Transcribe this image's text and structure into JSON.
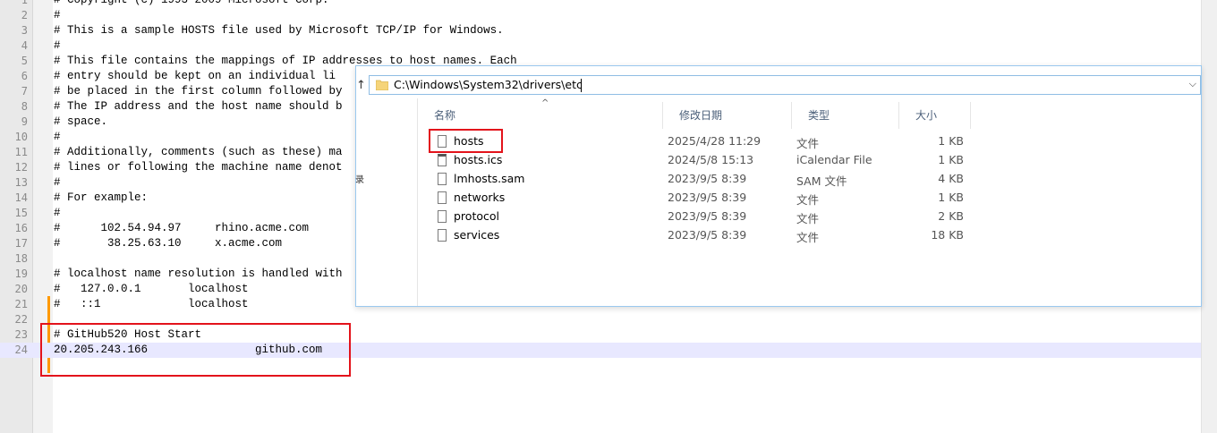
{
  "editor": {
    "lines": [
      {
        "num": "1",
        "text": "# Copyright (c) 1993-2009 Microsoft Corp."
      },
      {
        "num": "2",
        "text": "#"
      },
      {
        "num": "3",
        "text": "# This is a sample HOSTS file used by Microsoft TCP/IP for Windows."
      },
      {
        "num": "4",
        "text": "#"
      },
      {
        "num": "5",
        "text": "# This file contains the mappings of IP addresses to host names. Each"
      },
      {
        "num": "6",
        "text": "# entry should be kept on an individual li"
      },
      {
        "num": "7",
        "text": "# be placed in the first column followed by"
      },
      {
        "num": "8",
        "text": "# The IP address and the host name should b"
      },
      {
        "num": "9",
        "text": "# space."
      },
      {
        "num": "10",
        "text": "#"
      },
      {
        "num": "11",
        "text": "# Additionally, comments (such as these) ma"
      },
      {
        "num": "12",
        "text": "# lines or following the machine name denot"
      },
      {
        "num": "13",
        "text": "#"
      },
      {
        "num": "14",
        "text": "# For example:"
      },
      {
        "num": "15",
        "text": "#"
      },
      {
        "num": "16",
        "text": "#      102.54.94.97     rhino.acme.com"
      },
      {
        "num": "17",
        "text": "#       38.25.63.10     x.acme.com"
      },
      {
        "num": "18",
        "text": ""
      },
      {
        "num": "19",
        "text": "# localhost name resolution is handled with"
      },
      {
        "num": "20",
        "text": "#   127.0.0.1       localhost"
      },
      {
        "num": "21",
        "text": "#   ::1             localhost"
      },
      {
        "num": "22",
        "text": ""
      },
      {
        "num": "23",
        "text": "# GitHub520 Host Start"
      },
      {
        "num": "24",
        "text": "20.205.243.166                github.com"
      }
    ],
    "current_line": 24
  },
  "explorer": {
    "address_path": "C:\\Windows\\System32\\drivers\\etc",
    "columns": {
      "name": "名称",
      "date": "修改日期",
      "type": "类型",
      "size": "大小"
    },
    "files": [
      {
        "name": "hosts",
        "date": "2025/4/28 11:29",
        "type": "文件",
        "size": "1 KB"
      },
      {
        "name": "hosts.ics",
        "date": "2024/5/8 15:13",
        "type": "iCalendar File",
        "size": "1 KB"
      },
      {
        "name": "lmhosts.sam",
        "date": "2023/9/5 8:39",
        "type": "SAM 文件",
        "size": "4 KB"
      },
      {
        "name": "networks",
        "date": "2023/9/5 8:39",
        "type": "文件",
        "size": "1 KB"
      },
      {
        "name": "protocol",
        "date": "2023/9/5 8:39",
        "type": "文件",
        "size": "2 KB"
      },
      {
        "name": "services",
        "date": "2023/9/5 8:39",
        "type": "文件",
        "size": "18 KB"
      }
    ],
    "highlighted_file": "hosts"
  },
  "colors": {
    "highlight_box": "#e3131b",
    "change_bar": "#ff9900",
    "current_line": "#e8e8ff"
  }
}
